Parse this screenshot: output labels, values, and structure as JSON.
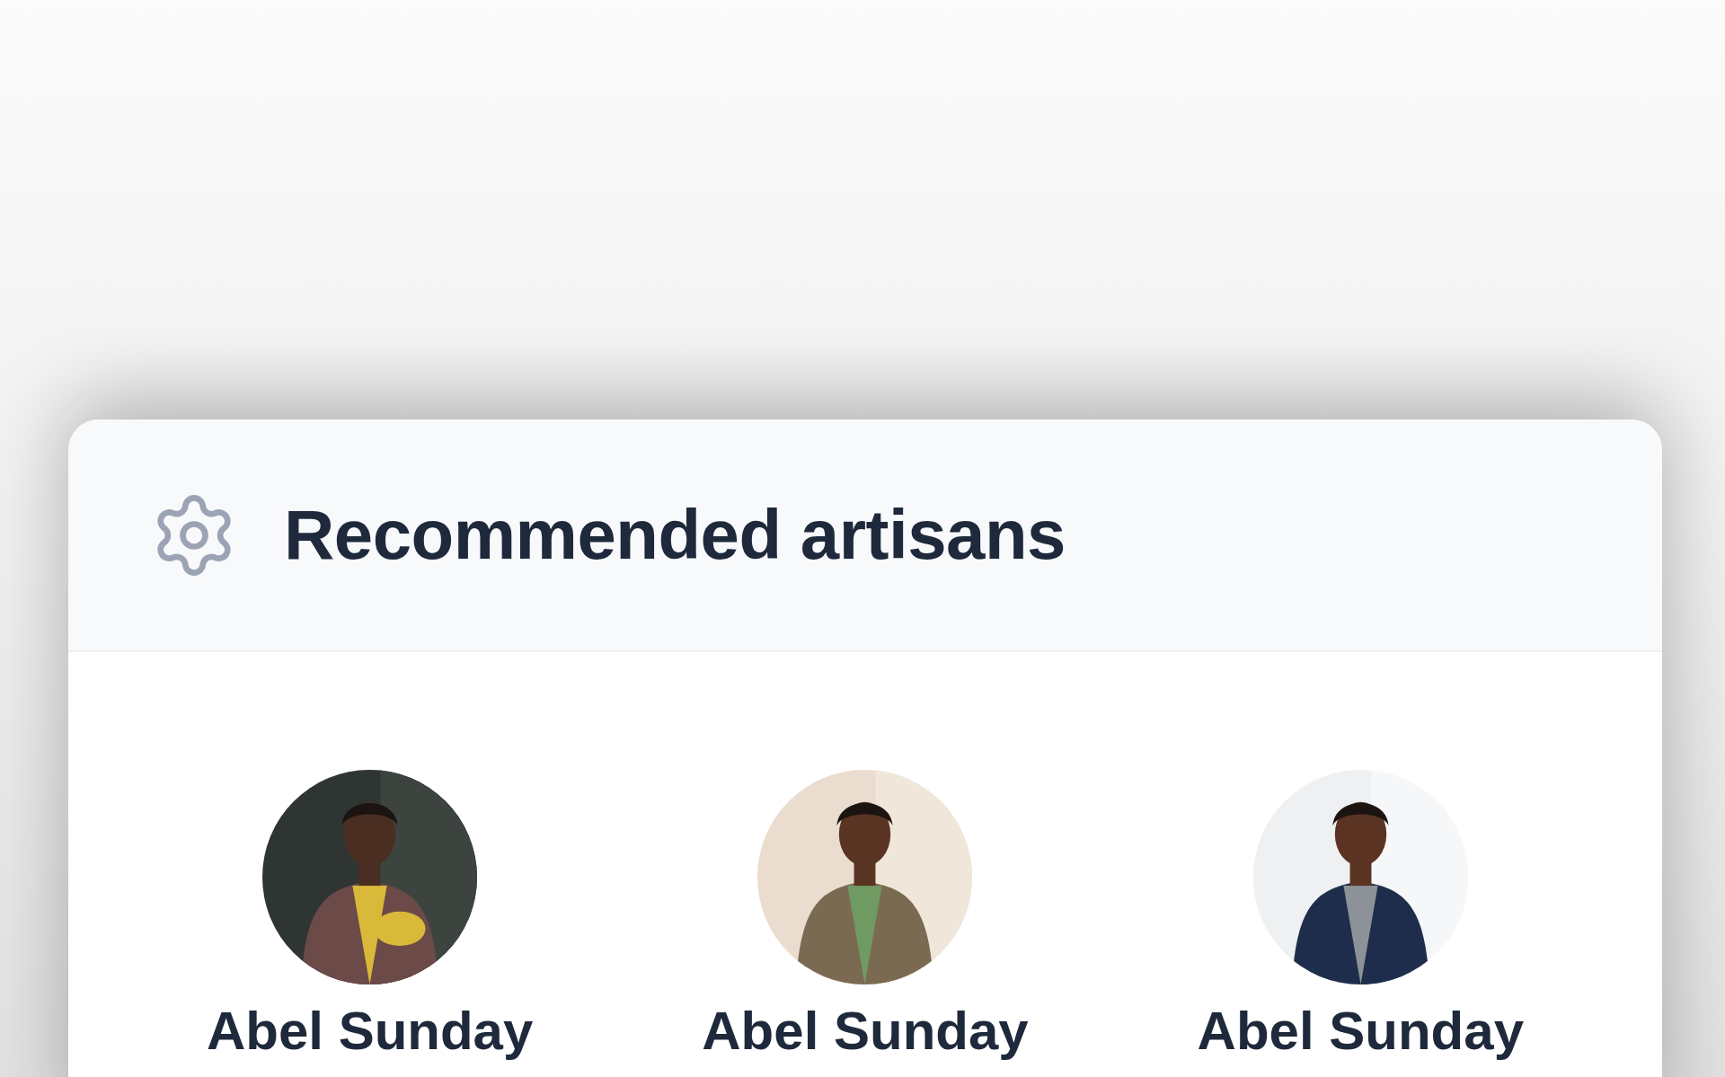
{
  "card": {
    "title": "Recommended artisans"
  },
  "artisans": [
    {
      "name": "Abel Sunday"
    },
    {
      "name": "Abel Sunday"
    },
    {
      "name": "Abel Sunday"
    }
  ]
}
